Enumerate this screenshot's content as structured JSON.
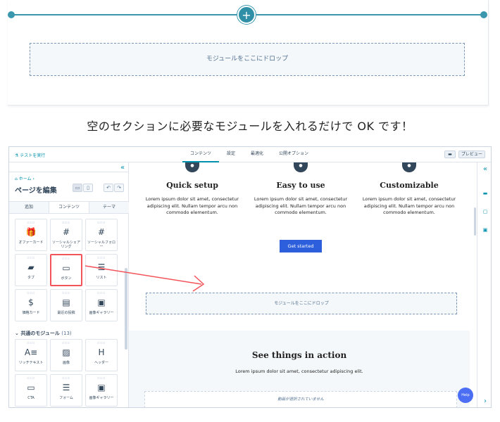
{
  "top_panel": {
    "plus_label": "+",
    "dropzone_label": "モジュールをここにドロップ"
  },
  "caption": "空のセクションに必要なモジュールを入れるだけで OK です！",
  "editor": {
    "test_link": "テストを実行",
    "tabs": [
      "コンテンツ",
      "設定",
      "最適化",
      "公開オプション"
    ],
    "chat_icon": "comment-icon",
    "preview_label": "プレビュー"
  },
  "sidebar": {
    "collapse": "«",
    "breadcrumb": "ホーム ›",
    "page_title": "ページを編集",
    "view_icons": [
      "desktop-icon",
      "mobile-icon"
    ],
    "undo": "↶",
    "redo": "↷",
    "tabs": [
      "追加",
      "コンテンツ",
      "テーマ"
    ],
    "modules_top": [
      {
        "label": "オファーカード",
        "icon": "gift-icon",
        "glyph": "🎁"
      },
      {
        "label": "ソーシャルシェアリング",
        "icon": "hashtag-icon",
        "glyph": "#"
      },
      {
        "label": "ソーシャルフォロー",
        "icon": "hashtag-icon",
        "glyph": "#"
      },
      {
        "label": "タブ",
        "icon": "folder-icon",
        "glyph": "▰"
      },
      {
        "label": "ボタン",
        "icon": "button-cursor-icon",
        "glyph": "▭"
      },
      {
        "label": "リスト",
        "icon": "list-icon",
        "glyph": "☰"
      },
      {
        "label": "価格カード",
        "icon": "price-icon",
        "glyph": "$"
      },
      {
        "label": "最近の投稿",
        "icon": "posts-icon",
        "glyph": "▤"
      },
      {
        "label": "画像ギャラリー",
        "icon": "gallery-icon",
        "glyph": "▣"
      }
    ],
    "section_title": "共通のモジュール",
    "section_count": "(13)",
    "modules_common": [
      {
        "label": "リッチテキスト",
        "icon": "rich-text-icon",
        "glyph": "A≡"
      },
      {
        "label": "画像",
        "icon": "image-icon",
        "glyph": "▨"
      },
      {
        "label": "ヘッダー",
        "icon": "header-icon",
        "glyph": "H"
      },
      {
        "label": "CTA",
        "icon": "cta-icon",
        "glyph": "▭"
      },
      {
        "label": "フォーム",
        "icon": "form-icon",
        "glyph": "☰"
      },
      {
        "label": "画像ギャラリー",
        "icon": "gallery-icon",
        "glyph": "▣"
      }
    ]
  },
  "canvas": {
    "features": [
      {
        "title": "Quick setup",
        "body": "Lorem ipsum dolor sit amet, consectetur adipiscing elit. Nullam tempor arcu non commodo elementum."
      },
      {
        "title": "Easy to use",
        "body": "Lorem ipsum dolor sit amet, consectetur adipiscing elit. Nullam tempor arcu non commodo elementum."
      },
      {
        "title": "Customizable",
        "body": "Lorem ipsum dolor sit amet, consectetur adipiscing elit. Nullam tempor arcu non commodo elementum."
      }
    ],
    "cta_label": "Get started",
    "dropzone_label": "モジュールをここにドロップ",
    "see_title": "See things in action",
    "see_sub": "Lorem ipsum dolor sit amet, consectetur adipiscing elit.",
    "video_label": "動画が選択されていません"
  },
  "rail": {
    "expand": "«",
    "next": "›"
  },
  "help_label": "Help",
  "colors": {
    "accent": "#3a97ad",
    "cta": "#2d5fdd",
    "highlight": "#f2545b"
  }
}
